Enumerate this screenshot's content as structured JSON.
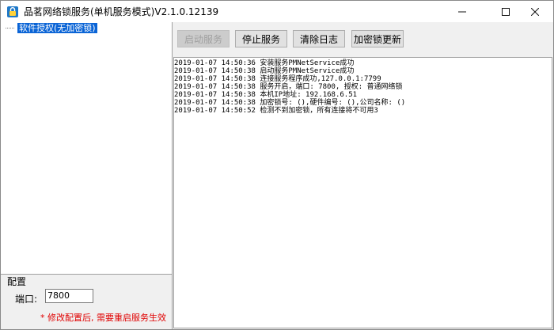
{
  "window": {
    "title": "品茗网络锁服务(单机服务模式)V2.1.0.12139",
    "icon": "app-lock-icon",
    "controls": [
      "minimize-icon",
      "maximize-icon",
      "close-icon"
    ]
  },
  "tree": {
    "items": [
      {
        "label": "软件授权(无加密锁)",
        "selected": true
      }
    ]
  },
  "toolbar": {
    "start_label": "启动服务",
    "stop_label": "停止服务",
    "clear_label": "清除日志",
    "update_label": "加密锁更新"
  },
  "log": {
    "lines": [
      "2019-01-07 14:50:36 安装服务PMNetService成功",
      "2019-01-07 14:50:38 启动服务PMNetService成功",
      "2019-01-07 14:50:38 连接服务程序成功,127.0.0.1:7799",
      "2019-01-07 14:50:38 服务开启，端口: 7800, 授权: 普通网络锁",
      "2019-01-07 14:50:38 本机IP地址: 192.168.6.51",
      "2019-01-07 14:50:38 加密锁号: (),硬件编号: (),公司名称: ()",
      "2019-01-07 14:50:52 检测不到加密锁，所有连接将不可用3"
    ]
  },
  "config": {
    "title": "配置",
    "port_label": "端口:",
    "port_value": "7800",
    "note": "* 修改配置后, 需要重启服务生效",
    "note_color": "#e00000"
  },
  "colors": {
    "selection": "#0a64d6"
  }
}
